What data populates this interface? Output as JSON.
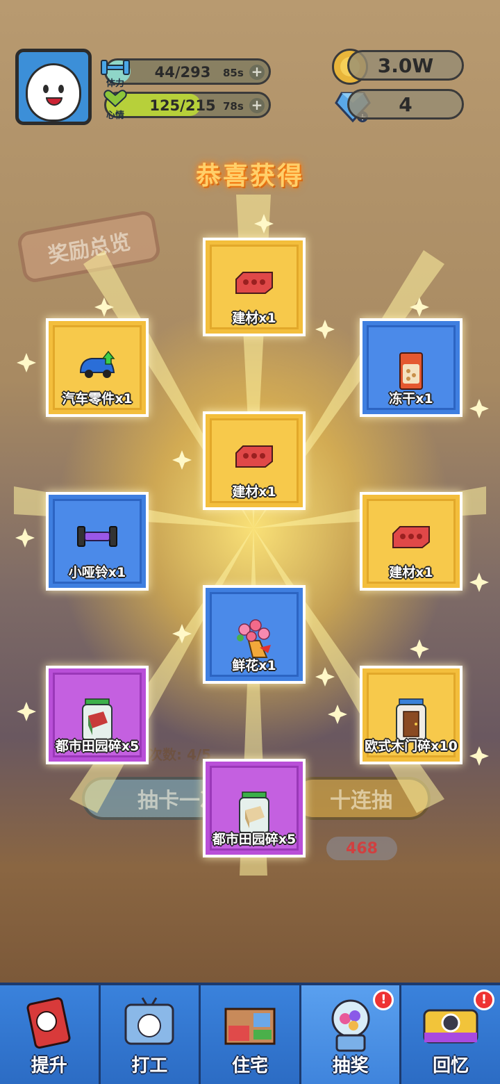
{
  "hud": {
    "stamina": {
      "label": "体力",
      "value": "44/293",
      "timer": "85s",
      "fill": 0.15
    },
    "mood": {
      "label": "心情",
      "value": "125/215",
      "timer": "78s",
      "fill": 0.58
    },
    "coins": "3.0W",
    "gems": "4"
  },
  "title": "恭喜获得",
  "background": {
    "reward_overview": "奖励总览",
    "draw_count": "次数: 4/5",
    "draw_once": "抽卡一次",
    "draw_ten": "十连抽",
    "gem_cost": "468"
  },
  "rewards": [
    {
      "label": "建材x1",
      "color": "yellow",
      "icon": "brick-icon"
    },
    {
      "label": "汽车零件x1",
      "color": "yellow",
      "icon": "car-part-icon"
    },
    {
      "label": "冻干x1",
      "color": "blue",
      "icon": "freeze-dried-food-icon"
    },
    {
      "label": "建材x1",
      "color": "yellow",
      "icon": "brick-icon"
    },
    {
      "label": "小哑铃x1",
      "color": "blue",
      "icon": "dumbbell-icon"
    },
    {
      "label": "建材x1",
      "color": "yellow",
      "icon": "brick-icon"
    },
    {
      "label": "鲜花x1",
      "color": "blue",
      "icon": "flower-bouquet-icon"
    },
    {
      "label": "都市田园碎x5",
      "color": "purple",
      "icon": "urban-garden-fragment-icon"
    },
    {
      "label": "欧式木门碎x10",
      "color": "yellow",
      "icon": "wooden-door-fragment-icon"
    },
    {
      "label": "都市田园碎x5",
      "color": "purple",
      "icon": "urban-garden-fragment-icon"
    }
  ],
  "nav": [
    {
      "label": "提升",
      "icon": "book-icon",
      "alert": false
    },
    {
      "label": "打工",
      "icon": "work-tv-icon",
      "alert": false
    },
    {
      "label": "住宅",
      "icon": "house-icon",
      "alert": false
    },
    {
      "label": "抽奖",
      "icon": "gacha-machine-icon",
      "alert": true
    },
    {
      "label": "回忆",
      "icon": "camera-icon",
      "alert": true
    }
  ],
  "alert_symbol": "!"
}
